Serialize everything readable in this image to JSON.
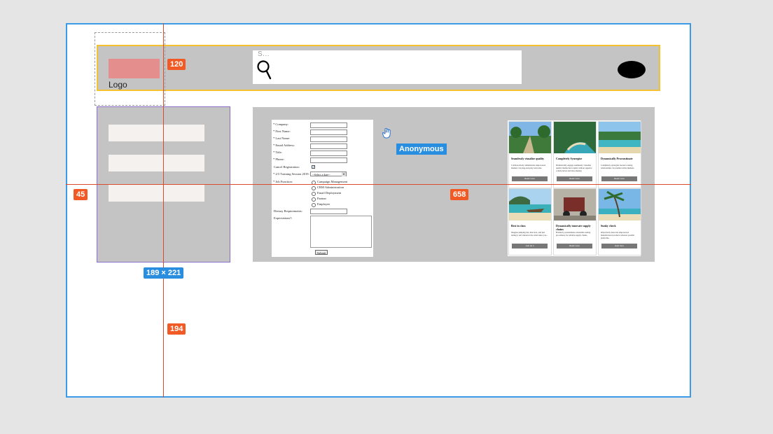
{
  "header": {
    "logo_text": "Logo",
    "search_placeholder": "S...",
    "accent_color": "#f4c230"
  },
  "sidebar": {
    "items": [
      "",
      "",
      ""
    ],
    "border_color": "#8a6ec7"
  },
  "form": {
    "fields": [
      {
        "label": "* Company:",
        "type": "text"
      },
      {
        "label": "* First Name:",
        "type": "text"
      },
      {
        "label": "* Last Name:",
        "type": "text"
      },
      {
        "label": "* Email Address:",
        "type": "text"
      },
      {
        "label": "* Title:",
        "type": "text"
      },
      {
        "label": "* Phone:",
        "type": "text"
      },
      {
        "label": "Cancel Registration:",
        "type": "checkbox"
      },
      {
        "label": "* 2/3 Training Session 2019:",
        "type": "select"
      }
    ],
    "select_value": "--Select a date--",
    "job_function_label": "* Job Function:",
    "job_functions": [
      "Campaign Management",
      "CRM Administration",
      "Email Deployment",
      "Partner",
      "Employee"
    ],
    "dietary_label": "Dietary Requirements:",
    "expectations_label": "Expectations?:",
    "submit_label": "Submit"
  },
  "user_badge": "Anonymous",
  "cards": [
    {
      "title": "Seamlessly visualize quality",
      "body": "Collaboratively administrate empowered markets via plug-and-play networks.",
      "button": "Read more",
      "image": "tropical-island-path"
    },
    {
      "title": "Completely Synergize",
      "body": "Dramatically engage seamlessly visualize quality intellectual capital without superior collaboration and idea-sharing.",
      "button": "Read more",
      "image": "beach-cove"
    },
    {
      "title": "Dynamically Procrastinate",
      "body": "Completely synergize resource taxing relationships via premier niche markets.",
      "button": "Read more",
      "image": "coastline"
    },
    {
      "title": "Best in class",
      "body": "Imagine jumping into that boat, and just letting it sail wherever the wind takes you...",
      "button": "Just do it",
      "image": "longtail-boat"
    },
    {
      "title": "Dynamically innovate supply chains",
      "body": "Holisticly predominate extensible testing procedures for reliable supply chains.",
      "button": "Read more",
      "image": "tuk-tuk"
    },
    {
      "title": "Sunky check",
      "body": "Objectively innovate empowered manufactured products whereas parallel platforms.",
      "button": "Help here",
      "image": "palm-beach"
    }
  ],
  "measurements": {
    "logo_gap": "120",
    "left_gap": "45",
    "right_gap": "658",
    "sidebar_size": "189 × 221",
    "bottom_gap": "194"
  },
  "colors": {
    "frame_border": "#3b9be8",
    "guide": "#d94b2b",
    "tag": "#f15a24",
    "dimension": "#2a8ee0"
  }
}
